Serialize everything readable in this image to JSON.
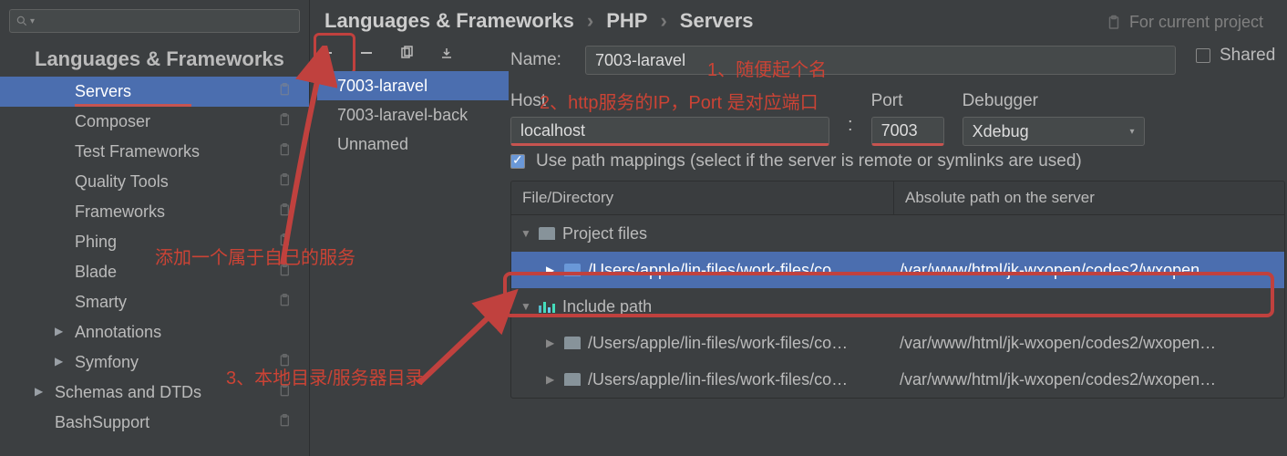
{
  "sidebar": {
    "section_title": "Languages & Frameworks",
    "items": [
      {
        "label": "Servers",
        "selected": true,
        "gear": true
      },
      {
        "label": "Composer",
        "gear": true
      },
      {
        "label": "Test Frameworks",
        "gear": true
      },
      {
        "label": "Quality Tools",
        "gear": true
      },
      {
        "label": "Frameworks",
        "gear": true
      },
      {
        "label": "Phing",
        "gear": true
      },
      {
        "label": "Blade",
        "gear": true
      },
      {
        "label": "Smarty",
        "gear": true
      },
      {
        "label": "Annotations",
        "expandable": true
      },
      {
        "label": "Symfony",
        "gear": true,
        "expandable": true
      },
      {
        "label": "Schemas and DTDs",
        "gear": true,
        "expandable": true,
        "level": 0
      },
      {
        "label": "BashSupport",
        "gear": true,
        "level": 0
      }
    ]
  },
  "breadcrumb": {
    "a": "Languages & Frameworks",
    "b": "PHP",
    "c": "Servers"
  },
  "scope": "For current project",
  "servers": [
    {
      "name": "7003-laravel",
      "selected": true
    },
    {
      "name": "7003-laravel-back"
    },
    {
      "name": "Unnamed"
    }
  ],
  "form": {
    "name_label": "Name:",
    "name_value": "7003-laravel",
    "shared_label": "Shared",
    "host_label": "Host",
    "host_value": "localhost",
    "port_label": "Port",
    "port_value": "7003",
    "debugger_label": "Debugger",
    "debugger_value": "Xdebug",
    "colon": ":",
    "path_check": "Use path mappings (select if the server is remote or symlinks are used)"
  },
  "table": {
    "col1": "File/Directory",
    "col2": "Absolute path on the server",
    "rows": [
      {
        "indent": 0,
        "open": true,
        "icon": "folder",
        "label": "Project files",
        "path": ""
      },
      {
        "indent": 1,
        "open": false,
        "icon": "folder-blue",
        "label": "/Users/apple/lin-files/work-files/co…",
        "path": "/var/www/html/jk-wxopen/codes2/wxopen…",
        "selected": true
      },
      {
        "indent": 0,
        "open": true,
        "icon": "include",
        "label": "Include path",
        "path": ""
      },
      {
        "indent": 1,
        "open": false,
        "icon": "folder",
        "label": "/Users/apple/lin-files/work-files/co…",
        "path": "/var/www/html/jk-wxopen/codes2/wxopen…"
      },
      {
        "indent": 1,
        "open": false,
        "icon": "folder",
        "label": "/Users/apple/lin-files/work-files/co…",
        "path": "/var/www/html/jk-wxopen/codes2/wxopen…"
      }
    ]
  },
  "annotations": {
    "a1": "1、随便起个名",
    "a2": "2、http服务的IP，Port 是对应端口",
    "a3": "添加一个属于自己的服务",
    "a4": "3、本地目录/服务器目录"
  }
}
